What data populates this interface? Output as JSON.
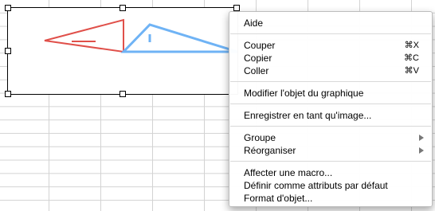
{
  "context_menu": {
    "help": "Aide",
    "cut": {
      "label": "Couper",
      "shortcut": "⌘X"
    },
    "copy": {
      "label": "Copier",
      "shortcut": "⌘C"
    },
    "paste": {
      "label": "Coller",
      "shortcut": "⌘V"
    },
    "edit_chart_object": "Modifier l'objet du graphique",
    "save_as_image": "Enregistrer en tant qu'image...",
    "group": "Groupe",
    "reorder": "Réorganiser",
    "assign_macro": "Affecter une macro...",
    "set_default_attributes": "Définir comme attributs par défaut",
    "format_object": "Format d'objet..."
  },
  "colors": {
    "red_shape": "#e0504a",
    "blue_shape": "#6fb3f5",
    "grid_line": "#d3d3d3",
    "menu_separator": "#d9d9d9"
  }
}
